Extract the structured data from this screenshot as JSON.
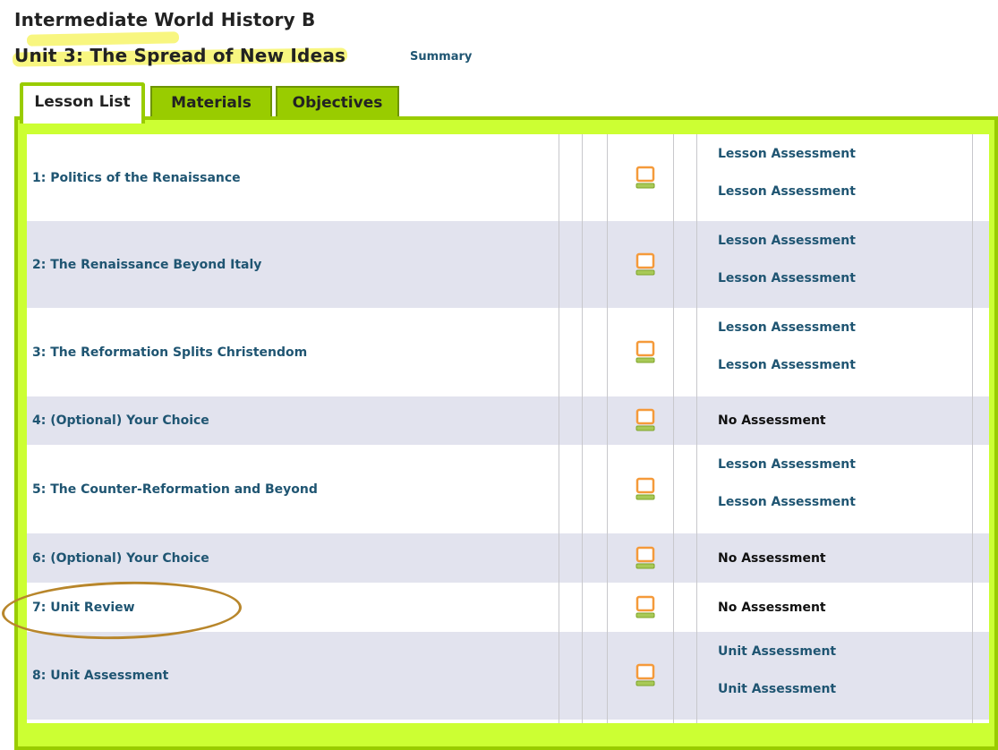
{
  "header": {
    "course_title": "Intermediate World History B",
    "unit_title": "Unit 3: The Spread of New Ideas",
    "summary_link": "Summary"
  },
  "tabs": [
    {
      "label": "Lesson List",
      "active": true
    },
    {
      "label": "Materials",
      "active": false
    },
    {
      "label": "Objectives",
      "active": false
    }
  ],
  "colors": {
    "tab_green": "#99cc00",
    "panel_green": "#ccff33",
    "link_blue": "#1f5572",
    "row_alt": "#e2e3ee",
    "icon_orange": "#f59a3a",
    "highlight_yellow": "#f7f46a"
  },
  "lesson_icon": "computer-monitor-icon",
  "lessons": [
    {
      "title": "1: Politics of the Renaissance",
      "assessments": [
        "Lesson Assessment",
        "Lesson Assessment"
      ]
    },
    {
      "title": "2: The Renaissance Beyond Italy",
      "assessments": [
        "Lesson Assessment",
        "Lesson Assessment"
      ]
    },
    {
      "title": "3: The Reformation Splits Christendom",
      "assessments": [
        "Lesson Assessment",
        "Lesson Assessment"
      ]
    },
    {
      "title": "4: (Optional) Your Choice",
      "no_assessment": "No Assessment"
    },
    {
      "title": "5: The Counter-Reformation and Beyond",
      "assessments": [
        "Lesson Assessment",
        "Lesson Assessment"
      ]
    },
    {
      "title": "6: (Optional) Your Choice",
      "no_assessment": "No Assessment"
    },
    {
      "title": "7: Unit Review",
      "no_assessment": "No Assessment"
    },
    {
      "title": "8: Unit Assessment",
      "assessments": [
        "Unit Assessment",
        "Unit Assessment"
      ]
    }
  ]
}
